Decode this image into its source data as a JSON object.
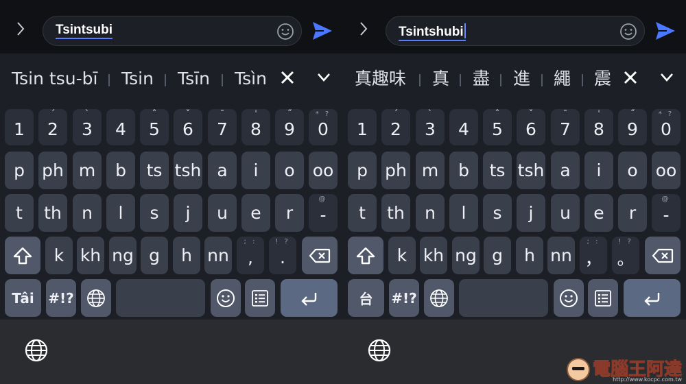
{
  "left": {
    "input": {
      "value": "Tsintsubi"
    },
    "suggestions": [
      "Tsin tsu-bī",
      "Tsin",
      "Tsīn",
      "Tsìn"
    ],
    "rows": {
      "numbers": [
        {
          "label": "1",
          "hint": ""
        },
        {
          "label": "2",
          "hint": "ˊ"
        },
        {
          "label": "3",
          "hint": "ˋ"
        },
        {
          "label": "4",
          "hint": ""
        },
        {
          "label": "5",
          "hint": "ˆ"
        },
        {
          "label": "6",
          "hint": "ˇ"
        },
        {
          "label": "7",
          "hint": "ˉ"
        },
        {
          "label": "8",
          "hint": "ˈ"
        },
        {
          "label": "9",
          "hint": "˝"
        },
        {
          "label": "0",
          "hint": "* ?"
        }
      ],
      "row2": [
        "p",
        "ph",
        "m",
        "b",
        "ts",
        "tsh",
        "a",
        "i",
        "o",
        "oo"
      ],
      "row3": [
        {
          "label": "t",
          "hint": ""
        },
        {
          "label": "th",
          "hint": ""
        },
        {
          "label": "n",
          "hint": ""
        },
        {
          "label": "l",
          "hint": ""
        },
        {
          "label": "s",
          "hint": ""
        },
        {
          "label": "j",
          "hint": ""
        },
        {
          "label": "u",
          "hint": ""
        },
        {
          "label": "e",
          "hint": ""
        },
        {
          "label": "r",
          "hint": ""
        },
        {
          "label": "-",
          "hint": "@"
        }
      ],
      "row4": [
        {
          "label": "k",
          "hint": ""
        },
        {
          "label": "kh",
          "hint": ""
        },
        {
          "label": "ng",
          "hint": ""
        },
        {
          "label": "g",
          "hint": ""
        },
        {
          "label": "h",
          "hint": ""
        },
        {
          "label": "nn",
          "hint": ""
        },
        {
          "label": ",",
          "hint": "; :"
        },
        {
          "label": ".",
          "hint": "! ?"
        }
      ]
    },
    "lang_key": "Tâi",
    "symbols_key": "#!?"
  },
  "right": {
    "input": {
      "value": "Tsintshubi"
    },
    "suggestions": [
      "真趣味",
      "真",
      "盡",
      "進",
      "繩",
      "震"
    ],
    "rows": {
      "numbers": [
        {
          "label": "1",
          "hint": ""
        },
        {
          "label": "2",
          "hint": "ˊ"
        },
        {
          "label": "3",
          "hint": "ˋ"
        },
        {
          "label": "4",
          "hint": ""
        },
        {
          "label": "5",
          "hint": "ˆ"
        },
        {
          "label": "6",
          "hint": "ˇ"
        },
        {
          "label": "7",
          "hint": "ˉ"
        },
        {
          "label": "8",
          "hint": "ˈ"
        },
        {
          "label": "9",
          "hint": "˝"
        },
        {
          "label": "0",
          "hint": "* ?"
        }
      ],
      "row2": [
        "p",
        "ph",
        "m",
        "b",
        "ts",
        "tsh",
        "a",
        "i",
        "o",
        "oo"
      ],
      "row3": [
        {
          "label": "t",
          "hint": ""
        },
        {
          "label": "th",
          "hint": ""
        },
        {
          "label": "n",
          "hint": ""
        },
        {
          "label": "l",
          "hint": ""
        },
        {
          "label": "s",
          "hint": ""
        },
        {
          "label": "j",
          "hint": ""
        },
        {
          "label": "u",
          "hint": ""
        },
        {
          "label": "e",
          "hint": ""
        },
        {
          "label": "r",
          "hint": ""
        },
        {
          "label": "-",
          "hint": "@"
        }
      ],
      "row4": [
        {
          "label": "k",
          "hint": ""
        },
        {
          "label": "kh",
          "hint": ""
        },
        {
          "label": "ng",
          "hint": ""
        },
        {
          "label": "g",
          "hint": ""
        },
        {
          "label": "h",
          "hint": ""
        },
        {
          "label": "nn",
          "hint": ""
        },
        {
          "label": "，",
          "hint": "; :"
        },
        {
          "label": "。",
          "hint": "! ?"
        }
      ]
    },
    "lang_key": "台",
    "symbols_key": "#!?"
  },
  "icons": {
    "back": "chevron-right-icon",
    "emoji": "smiley-icon",
    "send": "send-icon",
    "dismiss": "close-icon",
    "expand": "chevron-down-icon",
    "shift": "shift-arrow-icon",
    "backspace": "backspace-icon",
    "globe": "globe-icon",
    "clipboard": "clipboard-list-icon",
    "enter": "enter-return-icon"
  },
  "colors": {
    "accent": "#5a7cff",
    "background": "#1d1f27",
    "key": "#3a3f4c",
    "enter_key": "#5c6983"
  },
  "watermark": {
    "name": "電腦王阿達",
    "url": "http://www.kocpc.com.tw"
  }
}
